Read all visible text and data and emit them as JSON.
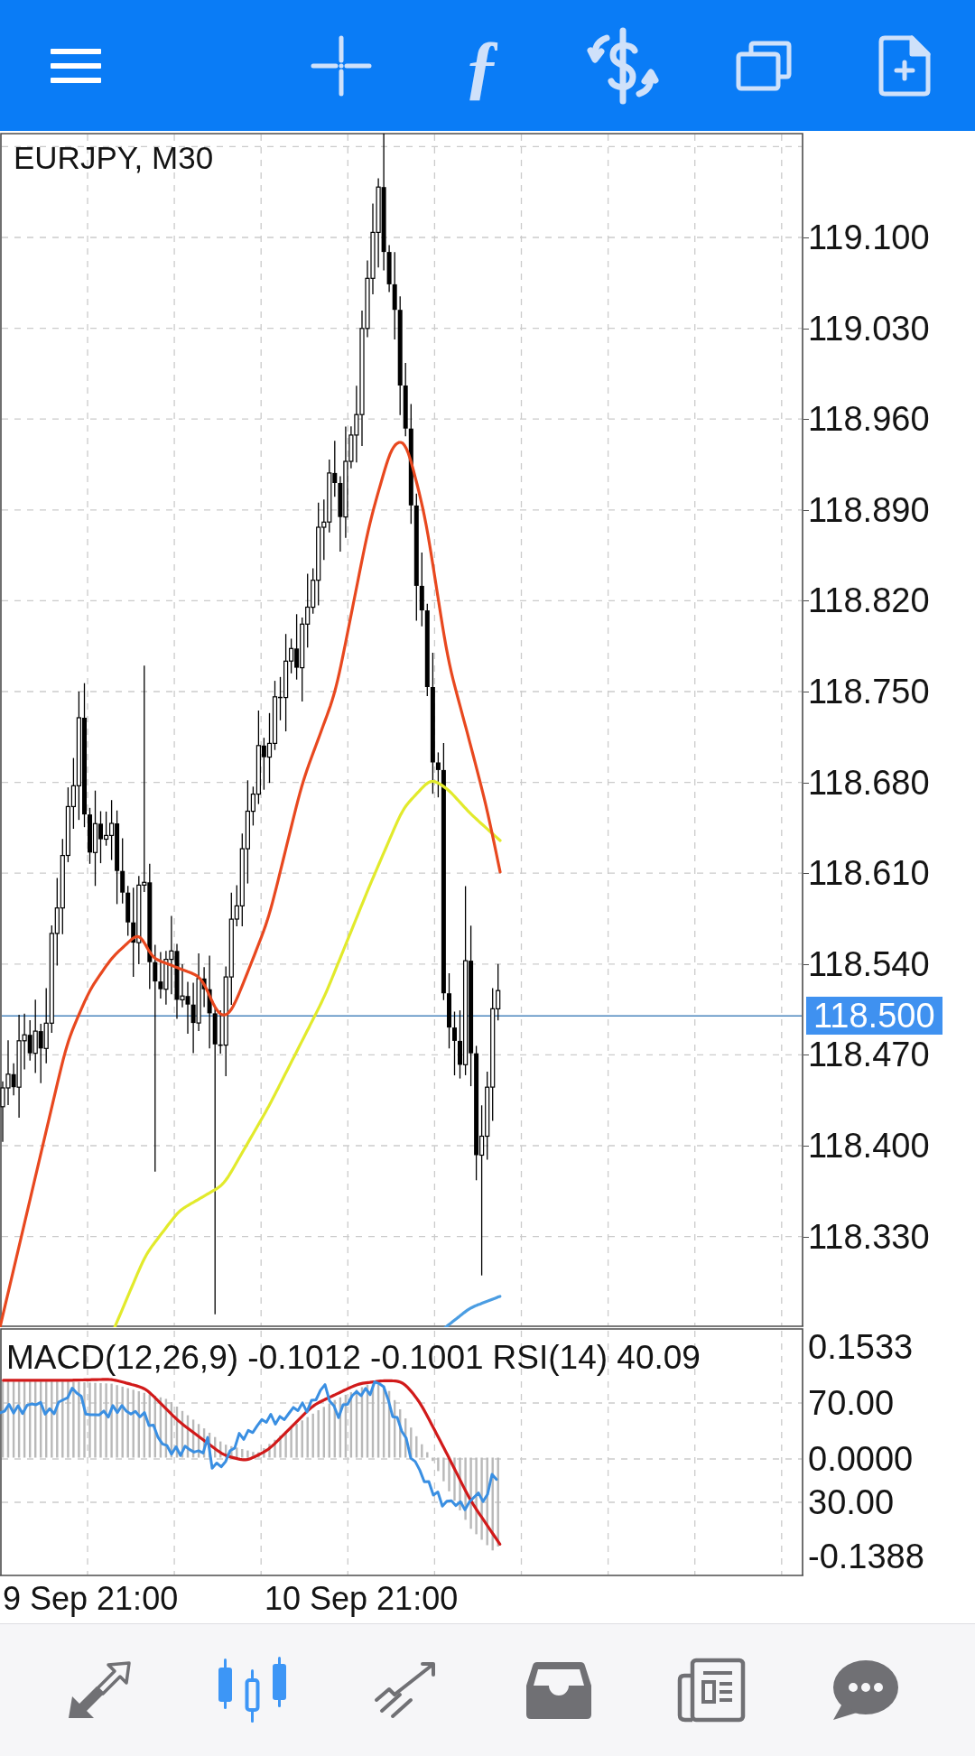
{
  "toolbar": {
    "buttons": [
      {
        "kind": "menu"
      },
      {
        "kind": "crosshair"
      },
      {
        "kind": "glyph",
        "label": "ƒ"
      },
      {
        "kind": "exchange"
      },
      {
        "kind": "windows"
      },
      {
        "kind": "add-document"
      }
    ]
  },
  "chart": {
    "symbol": "EURJPY, M30",
    "price_axis": [
      "119.100",
      "119.030",
      "118.960",
      "118.890",
      "118.820",
      "118.750",
      "118.680",
      "118.610",
      "118.540",
      "118.470",
      "118.400",
      "118.330"
    ],
    "current_price": "118.500",
    "indicator_legends": [
      "MACD(12,26,9) -0.1012 -0.1001",
      "RSI(14) 40.09"
    ],
    "indicator_axis": [
      "0.1533",
      "70.00",
      "0.0000",
      "30.00",
      "-0.1388"
    ],
    "time_axis": [
      "9 Sep 21:00",
      "10 Sep 21:00"
    ]
  },
  "bottom_nav": {
    "tabs": [
      {
        "kind": "quotes",
        "selected": false
      },
      {
        "kind": "chart",
        "selected": true
      },
      {
        "kind": "trade",
        "selected": false
      },
      {
        "kind": "history",
        "selected": false
      },
      {
        "kind": "news",
        "selected": false
      },
      {
        "kind": "messages",
        "selected": false
      }
    ]
  }
}
